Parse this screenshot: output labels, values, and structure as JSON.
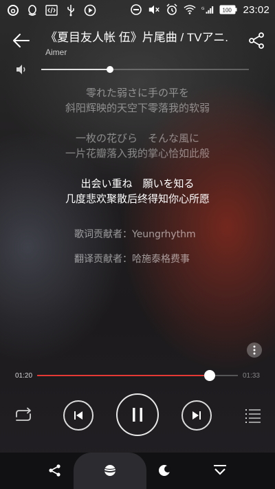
{
  "status_bar": {
    "time": "23:02",
    "battery_label": "100",
    "icons": [
      "netease-music-icon",
      "qq-icon",
      "code-icon",
      "usb-icon",
      "play-circle-icon",
      "block-icon",
      "mute-icon",
      "alarm-icon",
      "wifi-icon",
      "signal-icon",
      "battery-icon"
    ]
  },
  "header": {
    "title": "《夏目友人帐 伍》片尾曲 / TVアニ.",
    "artist": "Aimer"
  },
  "volume": {
    "level": 0.33
  },
  "lyrics": [
    {
      "original": "零れた弱さに手の平を",
      "translation": "斜阳辉映的天空下零落我的软弱",
      "active": false
    },
    {
      "original": "一枚の花びら　そんな風に",
      "translation": "一片花瓣落入我的掌心恰如此般",
      "active": false
    },
    {
      "original": "出会い重ね　願いを知る",
      "translation": "几度悲欢聚散后终得知你心所愿",
      "active": true
    }
  ],
  "credits": {
    "lyrics_contributor": "歌词贡献者：Yeungrhythm",
    "translation_contributor": "翻译贡献者：哈施泰格费事"
  },
  "playback": {
    "current_time": "01:20",
    "total_time": "01:33",
    "progress": 0.86
  },
  "colors": {
    "accent": "#e53935"
  }
}
